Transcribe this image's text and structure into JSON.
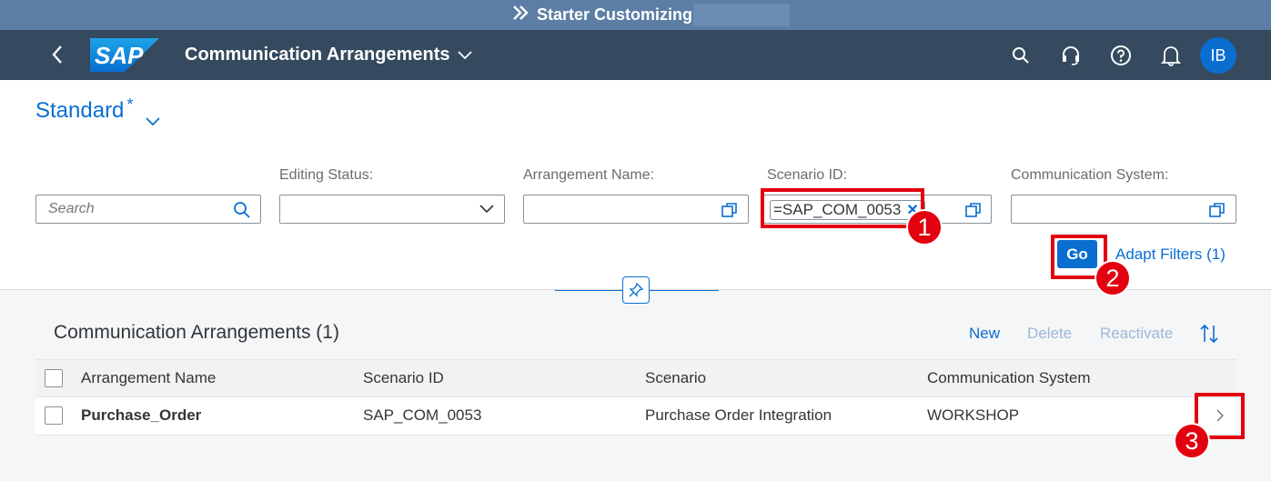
{
  "top_strip": {
    "title": "Starter Customizing",
    "icon": "double-chevron-right-icon"
  },
  "shellbar": {
    "logo_text": "SAP",
    "app_title": "Communication Arrangements",
    "avatar_initials": "IB",
    "icons": [
      "back-icon",
      "search-icon",
      "headset-icon",
      "help-icon",
      "bell-icon"
    ]
  },
  "variant": {
    "name": "Standard",
    "modified_marker": "*"
  },
  "filters": {
    "search": {
      "placeholder": "Search"
    },
    "editing_status": {
      "label": "Editing Status:",
      "value": ""
    },
    "arrangement_name": {
      "label": "Arrangement Name:",
      "value": ""
    },
    "scenario_id": {
      "label": "Scenario ID:",
      "token": "=SAP_COM_0053"
    },
    "communication_system": {
      "label": "Communication System:",
      "value": ""
    },
    "go_label": "Go",
    "adapt_filters_label": "Adapt Filters (1)"
  },
  "table": {
    "title": "Communication Arrangements (1)",
    "toolbar": {
      "new": "New",
      "delete": "Delete",
      "reactivate": "Reactivate"
    },
    "columns": [
      "Arrangement Name",
      "Scenario ID",
      "Scenario",
      "Communication System"
    ],
    "rows": [
      {
        "arrangement_name": "Purchase_Order",
        "scenario_id": "SAP_COM_0053",
        "scenario": "Purchase Order Integration",
        "communication_system": "WORKSHOP"
      }
    ]
  },
  "annotations": {
    "badge1": "1",
    "badge2": "2",
    "badge3": "3"
  },
  "colors": {
    "shell": "#354a5f",
    "accent": "#0a6ed1",
    "annotation": "#e3000f",
    "top_strip": "#5c7ea6"
  }
}
